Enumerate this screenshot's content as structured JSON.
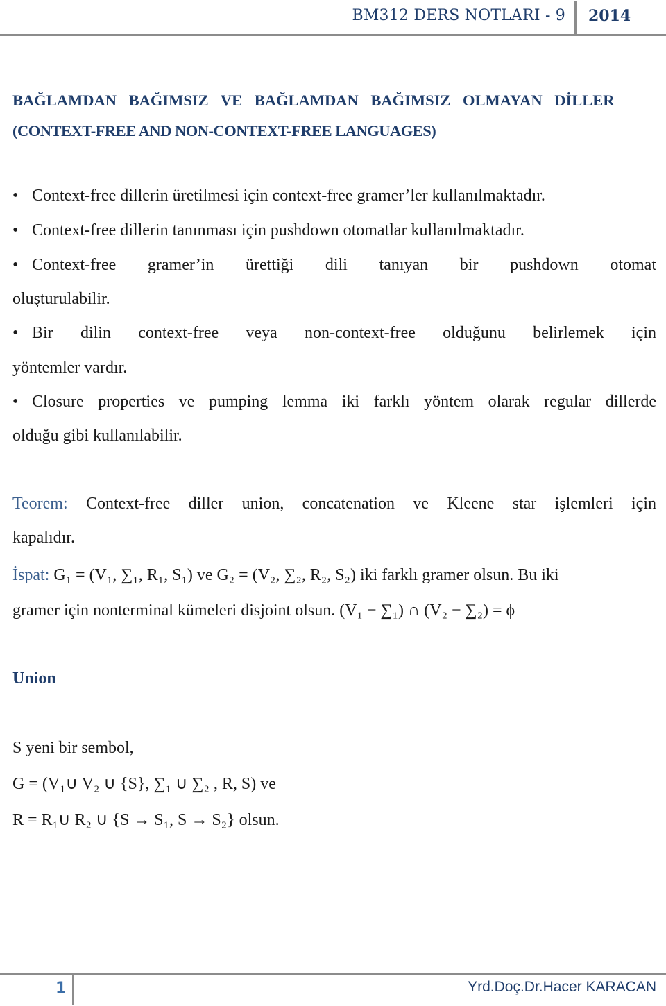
{
  "header": {
    "title": "BM312 DERS NOTLARI - 9",
    "year": "2014"
  },
  "title": {
    "line1": "BAĞLAMDAN BAĞIMSIZ VE BAĞLAMDAN BAĞIMSIZ OLMAYAN DİLLER",
    "line2": "(CONTEXT-FREE AND NON-CONTEXT-FREE LANGUAGES)"
  },
  "bullets": [
    {
      "text": "Context-free dillerin üretilmesi için context-free gramer’ler kullanılmaktadır."
    },
    {
      "text": "Context-free dillerin tanınması için pushdown otomatlar kullanılmaktadır."
    },
    {
      "text": "Context-free gramer’in ürettiği dili tanıyan bir pushdown otomat",
      "cont": "oluşturulabilir."
    },
    {
      "text": "Bir dilin context-free veya non-context-free olduğunu belirlemek için",
      "cont": "yöntemler vardır."
    },
    {
      "text": "Closure properties ve pumping lemma iki farklı yöntem olarak regular dillerde",
      "cont": "olduğu gibi kullanılabilir."
    }
  ],
  "bullet_symbol": "•",
  "theorem": {
    "label": "Teorem:",
    "text": " Context-free diller union, concatenation ve Kleene star işlemleri için",
    "cont": "kapalıdır."
  },
  "proof": {
    "label": "İspat:",
    "line1": " G₁ = (V₁, ∑₁, R₁, S₁) ve G₂ = (V₂, ∑₂, R₂, S₂) iki farklı gramer olsun. Bu iki",
    "line2": "gramer için nonterminal kümeleri disjoint olsun. (V₁ − ∑₁) ∩ (V₂ − ∑₂) = ϕ"
  },
  "section": {
    "heading": "Union",
    "line1": "S yeni bir sembol,",
    "line2": "G = (V₁∪ V₂ ∪ {S}, ∑₁ ∪ ∑₂ , R, S) ve",
    "line3": "R = R₁∪ R₂ ∪ {S → S₁, S → S₂} olsun."
  },
  "footer": {
    "page_number": "1",
    "author": "Yrd.Doç.Dr.Hacer KARACAN"
  }
}
